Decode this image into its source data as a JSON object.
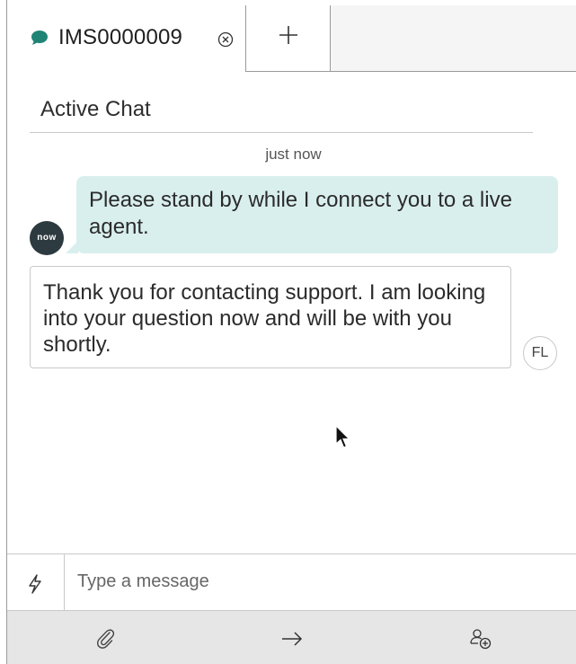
{
  "tabs": {
    "active_tab_label": "IMS0000009",
    "add_tab_label": "+"
  },
  "header": {
    "title": "Active Chat"
  },
  "conversation": {
    "timestamp": "just now",
    "messages": [
      {
        "sender": "bot",
        "avatar_text": "now",
        "text": "Please stand by while I connect you to a live agent."
      },
      {
        "sender": "agent",
        "avatar_text": "FL",
        "text": "Thank you for contacting support. I am looking into your question now and will be with you shortly."
      }
    ]
  },
  "composer": {
    "placeholder": "Type a message",
    "value": ""
  },
  "toolbar": {
    "icons": [
      "paperclip-icon",
      "arrow-right-icon",
      "add-user-icon"
    ]
  },
  "colors": {
    "bot_bubble": "#d9efee",
    "chat_icon": "#1f8476",
    "bot_avatar": "#2d3a3f",
    "toolbar_bg": "#e6e6e6"
  }
}
